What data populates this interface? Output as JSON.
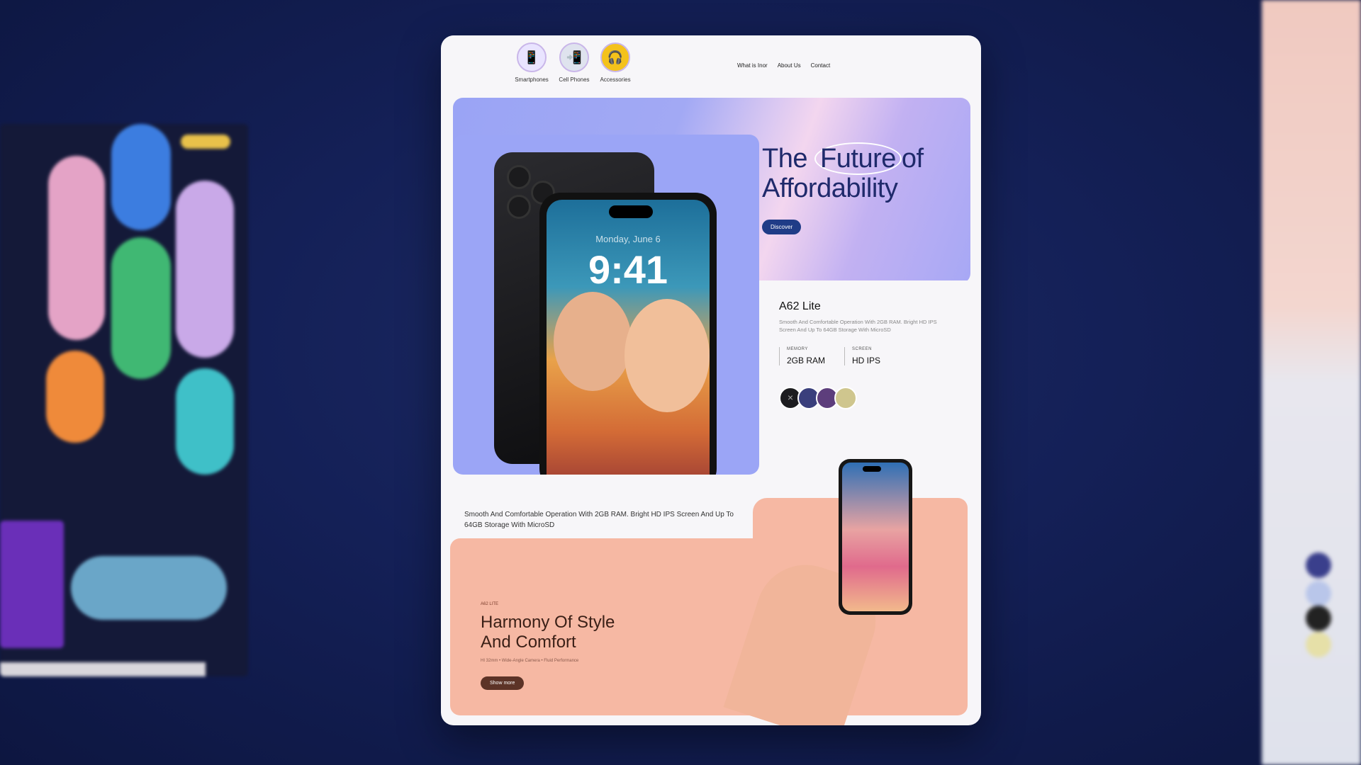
{
  "nav": {
    "categories": [
      {
        "label": "Smartphones",
        "icon": "smartphone-icon"
      },
      {
        "label": "Cell Phones",
        "icon": "cell-phone-icon"
      },
      {
        "label": "Accessories",
        "icon": "headphones-icon"
      }
    ],
    "links": [
      "What is Inor",
      "About Us",
      "Contact"
    ]
  },
  "hero": {
    "title_pre": "The",
    "title_highlight": "Future",
    "title_post": "of",
    "title_line2": "Affordability",
    "button": "Discover"
  },
  "phone_screen": {
    "date": "Monday, June 6",
    "time": "9:41"
  },
  "product": {
    "name": "A62 Lite",
    "description": "Smooth And Comfortable Operation With 2GB RAM. Bright HD IPS Screen And Up To 64GB Storage With MicroSD",
    "specs": [
      {
        "key": "MEMORY",
        "value": "2GB RAM"
      },
      {
        "key": "SCREEN",
        "value": "HD IPS"
      }
    ],
    "colors": [
      "#1c1c1f",
      "#3a3f7c",
      "#5d3e7c",
      "#cfc68e"
    ]
  },
  "promo": {
    "text": "Smooth And Comfortable Operation With 2GB RAM. Bright HD IPS Screen And Up To 64GB Storage With MicroSD",
    "label": "A62 LITE",
    "title_line1": "Harmony Of Style",
    "title_line2": "And Comfort",
    "subtitle": "HI 32mm  •  Wide-Angle Camera  •  Fluid Performance",
    "button": "Show more"
  },
  "colors": {
    "background": "#142057",
    "hero_accent": "#9aa4f5",
    "brand_blue": "#1f3c87",
    "peach": "#f6b8a3",
    "brown": "#5c3327"
  }
}
